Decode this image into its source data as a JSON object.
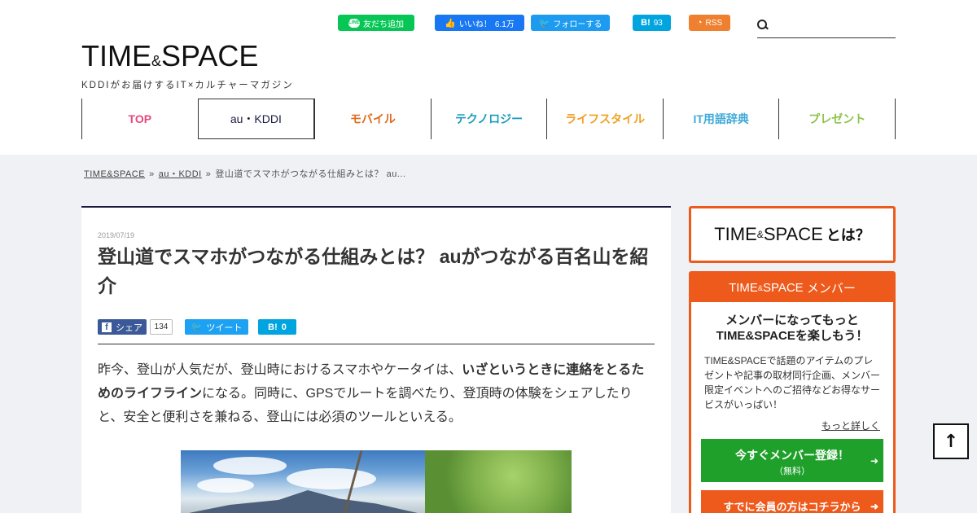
{
  "social": {
    "line_label": "友だち追加",
    "like_label": "いいね！",
    "like_count": "6.1万",
    "follow_label": "フォローする",
    "hatena_label": "B!",
    "hatena_count": "93",
    "rss_label": "RSS"
  },
  "search": {
    "placeholder": ""
  },
  "logo": {
    "part1": "TIME",
    "amp": "&",
    "part2": "SPACE",
    "tagline": "KDDIがお届けするIT×カルチャーマガジン"
  },
  "nav": {
    "items": [
      {
        "label": "TOP",
        "color": "#e8457f"
      },
      {
        "label": "au・KDDI",
        "color": "#1a1a40"
      },
      {
        "label": "モバイル",
        "color": "#e06a1c"
      },
      {
        "label": "テクノロジー",
        "color": "#1a9bbd"
      },
      {
        "label": "ライフスタイル",
        "color": "#f0a020"
      },
      {
        "label": "IT用語辞典",
        "color": "#3fa9d8"
      },
      {
        "label": "プレゼント",
        "color": "#8bc34a"
      }
    ]
  },
  "breadcrumb": {
    "home": "TIME&SPACE",
    "category": "au・KDDI",
    "current": "登山道でスマホがつながる仕組みとは？ au..."
  },
  "article": {
    "date": "2019/07/19",
    "title": "登山道でスマホがつながる仕組みとは？ auがつながる百名山を紹介",
    "share_fb": "シェア",
    "share_fb_count": "134",
    "share_tw": "ツイート",
    "share_hb": "B!",
    "share_hb_count": "0",
    "body_1": "昨今、登山が人気だが、登山時におけるスマホやケータイは、",
    "body_bold": "いざというときに連絡をとるためのライフライン",
    "body_2": "になる。同時に、GPSでルートを調べたり、登頂時の体験をシェアしたりと、安全と便利さを兼ねる、登山には必須のツールといえる。"
  },
  "sidebar": {
    "about_part1": "TIME",
    "about_amp": "&",
    "about_part2": "SPACE",
    "about_suffix": "とは？",
    "member_head_part1": "TIME",
    "member_head_amp": "&",
    "member_head_part2": "SPACE",
    "member_head_suffix": "メンバー",
    "member_lead_1": "メンバーになってもっと",
    "member_lead_2": "TIME&SPACEを楽しもう！",
    "member_desc": "TIME&SPACEで話題のアイテムのプレゼントや記事の取材同行企画、メンバー限定イベントへのご招待などお得なサービスがいっぱい！",
    "member_more": "もっと詳しく",
    "register_label": "今すぐメンバー登録！",
    "register_sub": "（無料）",
    "login_label": "すでに会員の方はコチラから"
  },
  "totop": {
    "label": "↑"
  }
}
